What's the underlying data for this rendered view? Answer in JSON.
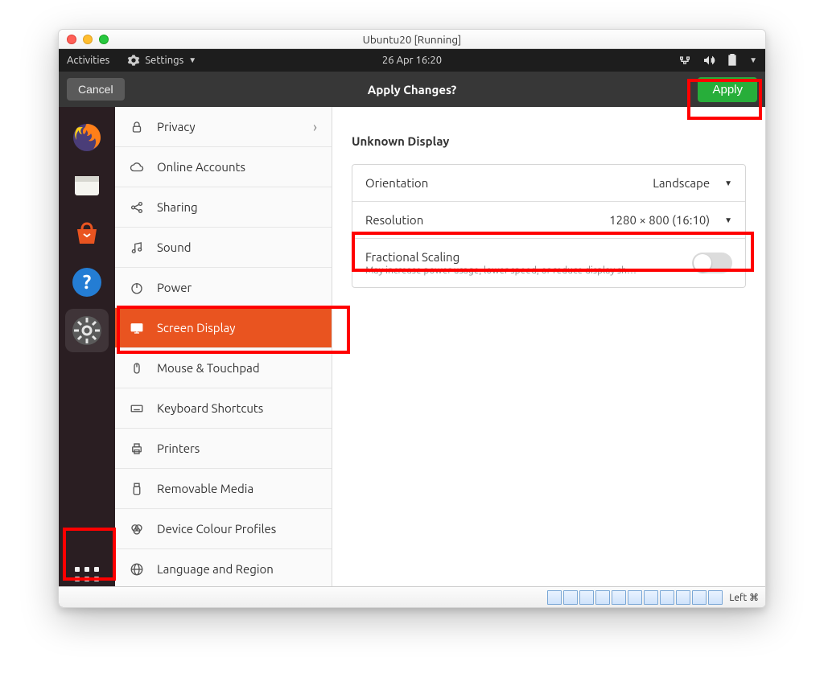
{
  "mac": {
    "title": "Ubuntu20 [Running]"
  },
  "topbar": {
    "activities": "Activities",
    "app": "Settings",
    "clock": "26 Apr  16:20"
  },
  "header": {
    "title": "Apply Changes?",
    "cancel": "Cancel",
    "apply": "Apply"
  },
  "sidebar": {
    "privacy": "Privacy",
    "online_accounts": "Online Accounts",
    "sharing": "Sharing",
    "sound": "Sound",
    "power": "Power",
    "screen_display": "Screen Display",
    "mouse": "Mouse & Touchpad",
    "keyboard": "Keyboard Shortcuts",
    "printers": "Printers",
    "removable": "Removable Media",
    "colour": "Device Colour Profiles",
    "language": "Language and Region"
  },
  "display": {
    "section_title": "Unknown Display",
    "orientation_label": "Orientation",
    "orientation_value": "Landscape",
    "resolution_label": "Resolution",
    "resolution_value": "1280 × 800 (16:10)",
    "fractional_label": "Fractional Scaling",
    "fractional_sub": "May increase power usage, lower speed, or reduce display sharp…"
  },
  "status": {
    "text": "Left ⌘"
  }
}
